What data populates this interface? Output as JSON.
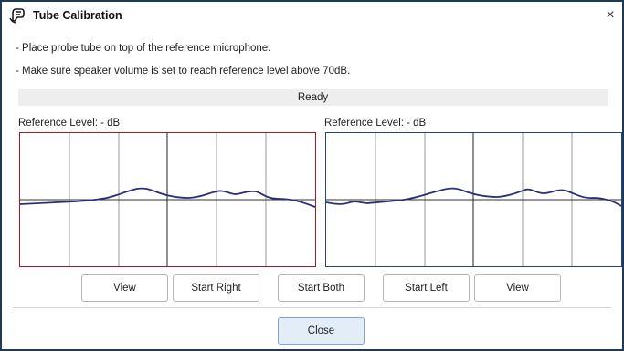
{
  "window": {
    "title": "Tube Calibration",
    "close_glyph": "×"
  },
  "instructions": [
    "- Place probe tube on top of the reference microphone.",
    "- Make sure speaker volume is set to reach reference level above 70dB."
  ],
  "status": "Ready",
  "panels": {
    "right": {
      "reference_label": "Reference Level: - dB",
      "border_color": "#a11d21",
      "curve_color": "#2b2f7a"
    },
    "left": {
      "reference_label": "Reference Level: - dB",
      "border_color": "#2b3f7a",
      "curve_color": "#2b2f7a"
    }
  },
  "buttons": {
    "view_right": "View",
    "start_right": "Start Right",
    "start_both": "Start Both",
    "start_left": "Start Left",
    "view_left": "View",
    "close": "Close"
  }
}
